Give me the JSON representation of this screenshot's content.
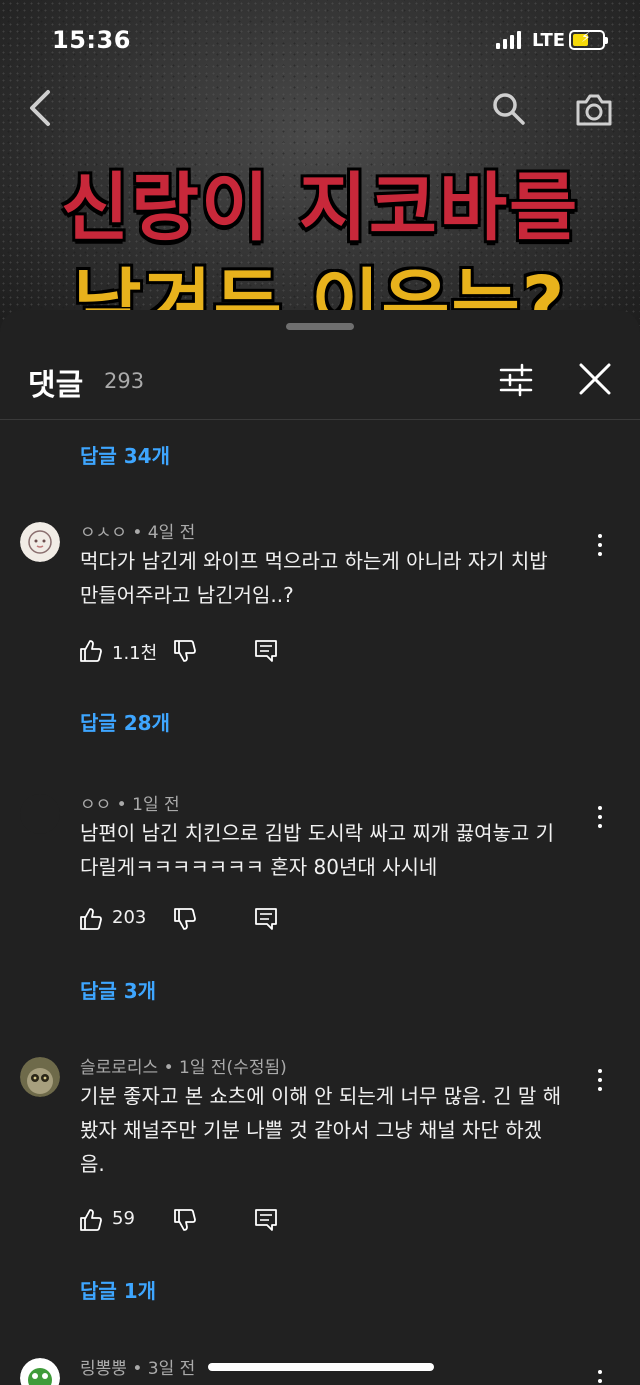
{
  "status_bar": {
    "time": "15:36",
    "network": "LTE"
  },
  "video": {
    "headline_line1": "신랑이 지코바를",
    "headline_line2": "남겨두 이유는?"
  },
  "sheet": {
    "title": "댓글",
    "count": "293"
  },
  "reply_links": {
    "r1": "답글 34개",
    "r2": "답글 28개",
    "r3": "답글 3개",
    "r4": "답글 1개"
  },
  "comments": [
    {
      "author": "ㅇㅅㅇ",
      "time": "4일 전",
      "line1": "먹다가 남긴게 와이프 먹으라고 하는게 아니라 자기 치밥",
      "line2": "만들어주라고 남긴거임..?",
      "line3": "",
      "likes": "1.1천"
    },
    {
      "author": "ㅇㅇ",
      "time": "1일 전",
      "line1": "남편이 남긴 치킨으로 김밥 도시락 싸고 찌개 끓여놓고 기",
      "line2": "다릴게ㅋㅋㅋㅋㅋㅋㅋ 혼자 80년대 사시네",
      "line3": "",
      "likes": "203"
    },
    {
      "author": "슬로로리스",
      "time": "1일 전(수정됨)",
      "line1": "기분 좋자고 본 쇼츠에 이해 안 되는게 너무 많음. 긴 말 해",
      "line2": "봤자 채널주만 기분 나쁠 것 같아서 그냥 채널 차단 하겠",
      "line3": "음.",
      "likes": "59"
    },
    {
      "author": "링뽕뿡",
      "time": "3일 전"
    }
  ],
  "colors": {
    "link": "#3ea6ff",
    "sheet_bg": "#212121",
    "headline_red": "#c8283a",
    "headline_yellow": "#e8b21c"
  }
}
